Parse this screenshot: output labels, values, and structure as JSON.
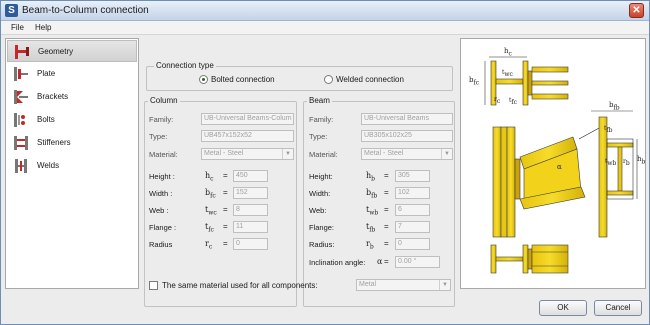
{
  "window": {
    "title": "Beam-to-Column connection",
    "app_icon": "S"
  },
  "menu": {
    "file": "File",
    "help": "Help"
  },
  "sidebar": {
    "items": [
      {
        "label": "Geometry",
        "icon": "geometry-icon",
        "active": true
      },
      {
        "label": "Plate",
        "icon": "plate-icon"
      },
      {
        "label": "Brackets",
        "icon": "brackets-icon"
      },
      {
        "label": "Bolts",
        "icon": "bolts-icon"
      },
      {
        "label": "Stiffeners",
        "icon": "stiffeners-icon"
      },
      {
        "label": "Welds",
        "icon": "welds-icon"
      }
    ]
  },
  "connection": {
    "legend": "Connection type",
    "bolted": "Bolted connection",
    "welded": "Welded connection",
    "selected": "bolted"
  },
  "column": {
    "legend": "Column",
    "family_label": "Family:",
    "family_value": "UB-Universal Beams-Colum",
    "type_label": "Type:",
    "type_value": "UB457x152x52",
    "material_label": "Material:",
    "material_value": "Metal - Steel",
    "height_label": "Height :",
    "height_sym": "h",
    "height_sub": "c",
    "height_value": "450",
    "width_label": "Width :",
    "width_sym": "b",
    "width_sub": "fc",
    "width_value": "152",
    "web_label": "Web :",
    "web_sym": "t",
    "web_sub": "wc",
    "web_value": "8",
    "flange_label": "Flange :",
    "flange_sym": "t",
    "flange_sub": "fc",
    "flange_value": "11",
    "radius_label": "Radius",
    "radius_sym": "r",
    "radius_sub": "c",
    "radius_value": "0"
  },
  "beam": {
    "legend": "Beam",
    "family_label": "Family:",
    "family_value": "UB-Universal Beams",
    "type_label": "Type:",
    "type_value": "UB305x102x25",
    "material_label": "Material:",
    "material_value": "Metal - Steel",
    "height_label": "Height:",
    "height_sym": "h",
    "height_sub": "b",
    "height_value": "305",
    "width_label": "Width:",
    "width_sym": "b",
    "width_sub": "fb",
    "width_value": "102",
    "web_label": "Web:",
    "web_sym": "t",
    "web_sub": "wb",
    "web_value": "6",
    "flange_label": "Flange:",
    "flange_sym": "t",
    "flange_sub": "fb",
    "flange_value": "7",
    "radius_label": "Radius:",
    "radius_sym": "r",
    "radius_sub": "b",
    "radius_value": "0",
    "incl_label": "Inclination angle:",
    "incl_sym": "α",
    "incl_value": "0.00 °"
  },
  "same_material": {
    "label": "The same material used for all components:",
    "value": "Metal",
    "checked": false
  },
  "buttons": {
    "ok": "OK",
    "cancel": "Cancel"
  },
  "diagram": {
    "hc": "h",
    "hc_sub": "c",
    "tfc_top": "t",
    "tfc_top_sub": "fc",
    "twc": "t",
    "twc_sub": "wc",
    "bfc": "b",
    "bfc_sub": "fc",
    "rc": "r",
    "rc_sub": "c",
    "tfc": "t",
    "tfc_sub": "fc",
    "bfb": "b",
    "bfb_sub": "fb",
    "tfb": "t",
    "tfb_sub": "fb",
    "twb": "t",
    "twb_sub": "wb",
    "rb": "r",
    "rb_sub": "b",
    "hb": "h",
    "hb_sub": "b",
    "alpha": "α"
  },
  "colors": {
    "steel": "#f2d21b",
    "steel_dark": "#b8a010",
    "highlight": "#c62828"
  }
}
